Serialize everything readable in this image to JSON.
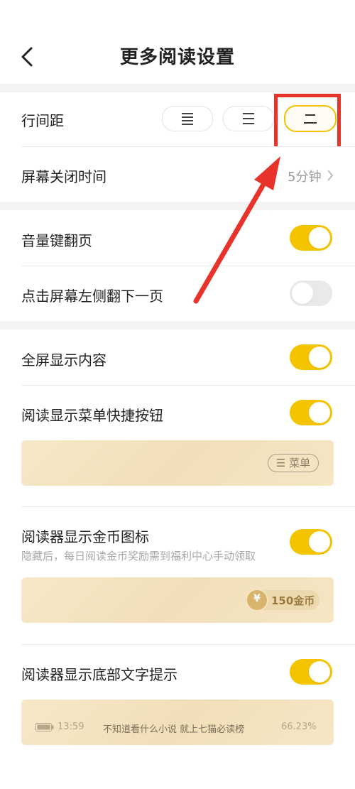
{
  "header": {
    "title": "更多阅读设置"
  },
  "line_spacing": {
    "label": "行间距",
    "options": [
      "≣",
      "☰",
      "二"
    ],
    "selected_index": 2
  },
  "screen_off": {
    "label": "屏幕关闭时间",
    "value": "5分钟"
  },
  "volume_key": {
    "label": "音量键翻页",
    "on": true
  },
  "tap_left": {
    "label": "点击屏幕左侧翻下一页",
    "on": false
  },
  "fullscreen": {
    "label": "全屏显示内容",
    "on": true
  },
  "menu_shortcut": {
    "label": "阅读显示菜单快捷按钮",
    "on": true,
    "preview_button": "☰ 菜单"
  },
  "coin_icon": {
    "label": "阅读器显示金币图标",
    "subtext": "隐藏后，每日阅读金币奖励需到福利中心手动领取",
    "on": true,
    "coin_symbol": "¥",
    "coin_text": "150金币"
  },
  "bottom_hint": {
    "label": "阅读器显示底部文字提示",
    "on": true,
    "time": "13:59",
    "hint_text": "不知道看什么小说 就上七猫必读榜",
    "progress": "66.23%"
  },
  "colors": {
    "accent": "#f5c400",
    "annotation": "#e8332a"
  }
}
